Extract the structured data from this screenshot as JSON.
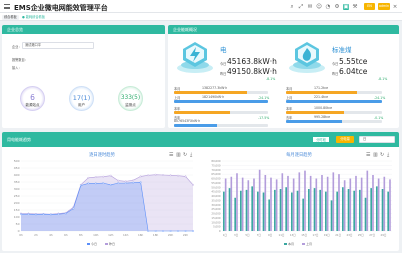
{
  "header": {
    "title": "EMS企业微电网能效管理平台",
    "icons": [
      "search-icon",
      "expand-icon",
      "message-icon",
      "user-icon",
      "bell-icon",
      "settings-icon",
      "language-icon",
      "tool-icon",
      "close-icon",
      "home-icon"
    ],
    "lang": "EN",
    "user": "admin"
  },
  "tabs": [
    {
      "label": "综合看板"
    },
    {
      "label": "● 能耗综合看板"
    }
  ],
  "enterprise": {
    "title": "企业总览",
    "company_label": "企业：",
    "company_value": "测试港口平",
    "item1": "报警数目：",
    "item2": "接入：",
    "circles": [
      {
        "value": "6",
        "label": "能源站点",
        "color": "#8b7fd4"
      },
      {
        "value": "17(1)",
        "label": "用户",
        "color": "#4a8ad8"
      },
      {
        "value": "333(5)",
        "label": "监测点",
        "color": "#2aaa6a"
      }
    ]
  },
  "energy": {
    "title": "企业能耗概况",
    "items": [
      {
        "name": "电",
        "today_label": "今日",
        "today": "45163.8kW·h",
        "yesterday_label": "昨日",
        "yesterday": "49150.8kW·h",
        "compare": "-8.1%",
        "rows": [
          {
            "label": "本月",
            "value": "1382277.3kW·h",
            "pct": "",
            "fill": 78
          },
          {
            "label": "上月",
            "value": "1821490kW·h",
            "pct": "-24.1%",
            "fill": 100
          },
          {
            "label": "本年",
            "value": "",
            "pct": "",
            "fill": 60
          },
          {
            "label": "去年",
            "value": "8076543FXkW·h",
            "pct": "-17.5%",
            "fill": 46
          }
        ]
      },
      {
        "name": "标准煤",
        "today_label": "今日",
        "today": "5.55tce",
        "yesterday_label": "昨日",
        "yesterday": "6.04tce",
        "compare": "-8.1%",
        "rows": [
          {
            "label": "本月",
            "value": "171.2tce",
            "pct": "",
            "fill": 74
          },
          {
            "label": "上月",
            "value": "221.4tce",
            "pct": "-24.1%",
            "fill": 100
          },
          {
            "label": "本年",
            "value": "1000.80tce",
            "pct": "",
            "fill": 60
          },
          {
            "label": "去年",
            "value": "995.28tce",
            "pct": "-0.1%",
            "fill": 58
          }
        ]
      }
    ]
  },
  "trend": {
    "title": "用电能耗趋势",
    "buttons": [
      "分时段",
      "分电量"
    ],
    "date": "日",
    "toolbar_icons": [
      "line-chart-icon",
      "bar-chart-icon",
      "refresh-icon",
      "download-icon"
    ]
  },
  "chart_data": [
    {
      "type": "area",
      "title": "逐日逐时趋势",
      "x": [
        "0h",
        "1h",
        "2h",
        "3h",
        "4h",
        "5h",
        "6h",
        "7h",
        "8h",
        "9h",
        "10h",
        "11h",
        "12h",
        "13h",
        "14h",
        "15h",
        "16h",
        "17h",
        "18h",
        "19h",
        "20h",
        "21h",
        "22h",
        "23h"
      ],
      "ylim": [
        0,
        500
      ],
      "yticks": [
        "0",
        "50",
        "100",
        "150",
        "200",
        "250",
        "300",
        "350",
        "400",
        "450",
        "500"
      ],
      "series": [
        {
          "name": "今日",
          "values": [
            120,
            120,
            118,
            120,
            118,
            120,
            125,
            160,
            325,
            340,
            340,
            342,
            330,
            342,
            342,
            345,
            348,
            0,
            0,
            0,
            0,
            0,
            0,
            0
          ],
          "color": "#5b8ff9"
        },
        {
          "name": "昨日",
          "values": [
            125,
            125,
            122,
            122,
            120,
            125,
            130,
            170,
            330,
            380,
            385,
            388,
            395,
            360,
            355,
            362,
            390,
            398,
            402,
            400,
            398,
            395,
            390,
            330
          ],
          "color": "#b39ddb"
        }
      ],
      "legend": "bottom"
    },
    {
      "type": "bar",
      "title": "每月逐日趋势",
      "categories": [
        "1日",
        "2日",
        "3日",
        "4日",
        "5日",
        "6日",
        "7日",
        "8日",
        "9日",
        "10日",
        "11日",
        "12日",
        "13日",
        "14日",
        "15日",
        "16日",
        "17日",
        "18日",
        "19日",
        "20日",
        "21日",
        "22日",
        "23日",
        "24日",
        "25日",
        "26日",
        "27日",
        "28日",
        "29日",
        "30日"
      ],
      "ylim": [
        0,
        80000
      ],
      "yticks": [
        "0",
        "5,000",
        "10,000",
        "15,000",
        "20,000",
        "25,000",
        "30,000",
        "35,000",
        "40,000",
        "45,000",
        "50,000",
        "55,000",
        "60,000",
        "65,000",
        "70,000",
        "75,000",
        "80,000"
      ],
      "series": [
        {
          "name": "本月",
          "values": [
            45000,
            49000,
            38000,
            46000,
            47000,
            51000,
            45000,
            44000,
            36000,
            47000,
            48000,
            50000,
            44000,
            46000,
            37000,
            48000,
            49000,
            47000,
            45000,
            35000,
            45000,
            50000,
            48000,
            46000,
            47000,
            38000,
            49000,
            51000,
            48000,
            45000
          ],
          "color": "#3aa6a0"
        },
        {
          "name": "上月",
          "values": [
            60000,
            62000,
            66000,
            61000,
            58000,
            60000,
            70000,
            64000,
            61000,
            59000,
            66000,
            63000,
            60000,
            67000,
            69000,
            63000,
            60000,
            64000,
            62000,
            67000,
            65000,
            58000,
            60000,
            63000,
            61000,
            69000,
            64000,
            60000,
            62000,
            59000
          ],
          "color": "#b39ddb"
        }
      ],
      "legend": "bottom"
    }
  ]
}
